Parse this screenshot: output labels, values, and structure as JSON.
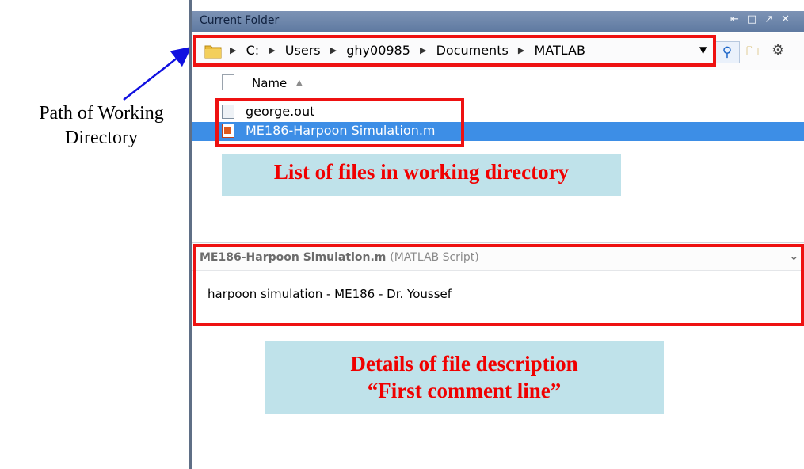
{
  "callouts": {
    "path_label_line1": "Path of Working",
    "path_label_line2": "Directory",
    "files_label": "List of files in working directory",
    "details_line1": "Details of file description",
    "details_line2": "“First comment line”"
  },
  "panel": {
    "title": "Current Folder",
    "window_controls": [
      "undock-icon",
      "maximize-icon",
      "minimize-icon",
      "close-icon"
    ]
  },
  "address_bar": {
    "crumbs": [
      "C:",
      "Users",
      "ghy00985",
      "Documents",
      "MATLAB"
    ]
  },
  "file_list": {
    "column_header": "Name",
    "sort_direction": "ascending",
    "files": [
      {
        "name": "george.out",
        "selected": false
      },
      {
        "name": "ME186-Harpoon Simulation.m",
        "selected": true
      }
    ]
  },
  "details": {
    "file_name": "ME186-Harpoon Simulation.m",
    "file_type": "(MATLAB Script)",
    "description": "harpoon simulation - ME186 - Dr. Youssef"
  },
  "colors": {
    "annotation_red": "#ee1111",
    "selection_blue": "#3d8ee6",
    "callout_bg": "#bfe2ea",
    "arrow_blue": "#1010e0"
  }
}
